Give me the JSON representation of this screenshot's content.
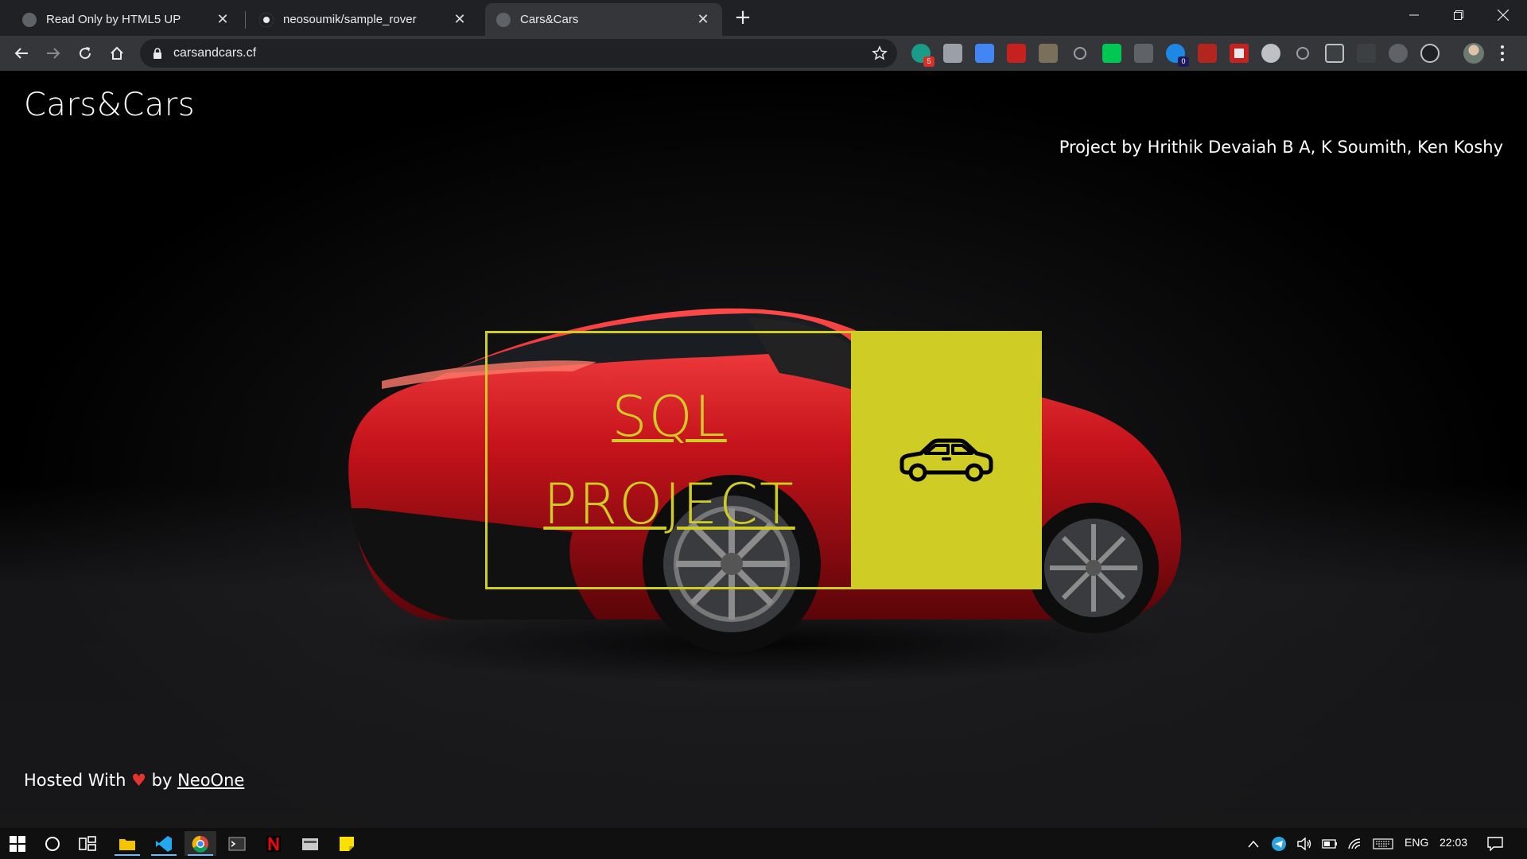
{
  "browser": {
    "tabs": [
      {
        "title": "Read Only by HTML5 UP",
        "icon": "globe-icon",
        "active": false
      },
      {
        "title": "neosoumik/sample_rover",
        "icon": "github-icon",
        "active": false
      },
      {
        "title": "Cars&Cars",
        "icon": "globe-icon",
        "active": true
      }
    ],
    "new_tab_symbol": "+",
    "address": "carsandcars.cf",
    "extension_badges": {
      "first": "5",
      "second": "0"
    }
  },
  "page": {
    "site_title": "Cars&Cars",
    "credit": "Project by Hrithik Devaiah B A, K Soumith, Ken Koshy",
    "hero": {
      "line1": "SQL",
      "line2": "PROJECT",
      "accent_color": "#cfcc26",
      "panel_icon": "car-icon"
    },
    "footer": {
      "prefix": "Hosted With",
      "heart": "♥",
      "by": "by",
      "author_link": "NeoOne"
    }
  },
  "taskbar": {
    "apps": [
      "start-icon",
      "search-icon",
      "task-view-icon",
      "file-explorer-icon",
      "vscode-icon",
      "chrome-icon",
      "terminal-icon",
      "netflix-icon",
      "files-icon",
      "sticky-notes-icon"
    ],
    "language": "ENG",
    "time": "22:03"
  }
}
